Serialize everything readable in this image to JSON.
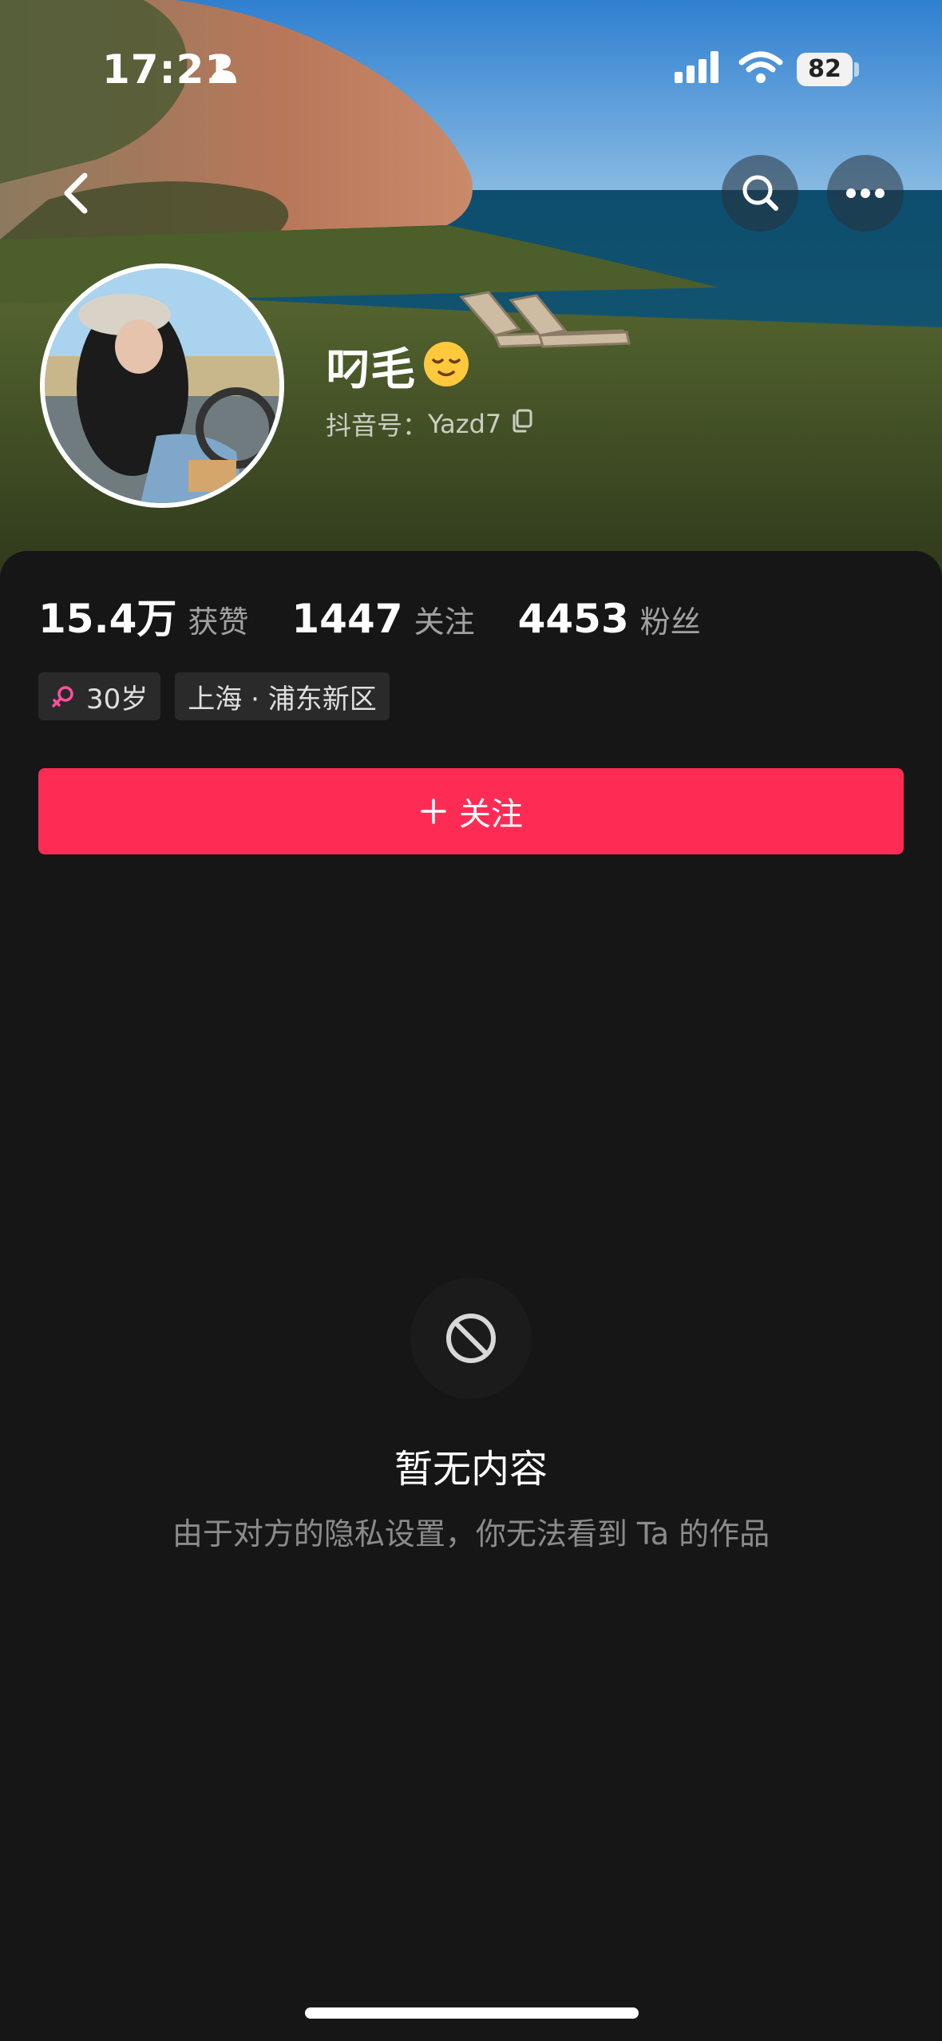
{
  "status_bar": {
    "time": "17:21",
    "battery": "82"
  },
  "nav": {
    "back_icon": "chevron-left-icon",
    "search_icon": "search-icon",
    "more_icon": "more-horizontal-icon"
  },
  "profile": {
    "nickname": "叼毛",
    "nickname_emoji": "relieved-face-emoji",
    "douyin_id_label": "抖音号：",
    "douyin_id": "Yazd7"
  },
  "stats": [
    {
      "value": "15.4万",
      "label": "获赞"
    },
    {
      "value": "1447",
      "label": "关注"
    },
    {
      "value": "4453",
      "label": "粉丝"
    }
  ],
  "tags": {
    "age": "30岁",
    "location": "上海 · 浦东新区"
  },
  "follow_button": {
    "label": "关注"
  },
  "empty_state": {
    "icon": "prohibited-icon",
    "title": "暂无内容",
    "description": "由于对方的隐私设置，你无法看到 Ta 的作品"
  },
  "colors": {
    "accent": "#fe2c55",
    "background": "#161616",
    "gender_icon": "#ff4fa0"
  }
}
